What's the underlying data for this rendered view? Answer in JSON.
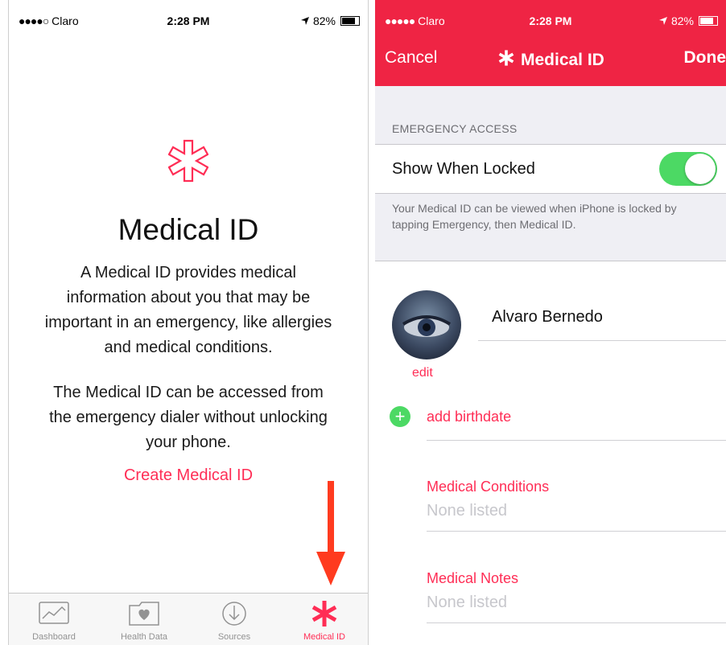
{
  "left": {
    "status": {
      "carrier": "Claro",
      "signal": "●●●●○",
      "time": "2:28 PM",
      "battery": "82%"
    },
    "title": "Medical ID",
    "description": "A Medical ID provides medical information about you that may be important in an emergency, like allergies and medical conditions.",
    "description2": "The Medical ID can be accessed from the emergency dialer without unlocking your phone.",
    "create_link": "Create Medical ID",
    "tabs": [
      {
        "label": "Dashboard",
        "icon": "dashboard-icon"
      },
      {
        "label": "Health Data",
        "icon": "health-data-icon"
      },
      {
        "label": "Sources",
        "icon": "sources-icon"
      },
      {
        "label": "Medical ID",
        "icon": "medical-id-icon"
      }
    ],
    "colors": {
      "accent": "#ff2d55",
      "arrow": "#ff3b1f"
    }
  },
  "right": {
    "status": {
      "carrier": "Claro",
      "signal": "●●●●●",
      "time": "2:28 PM",
      "battery": "82%"
    },
    "nav": {
      "cancel": "Cancel",
      "title": "Medical ID",
      "done": "Done"
    },
    "section_header": "EMERGENCY ACCESS",
    "toggle": {
      "label": "Show When Locked",
      "on": true
    },
    "note": "Your Medical ID can be viewed when iPhone is locked by tapping Emergency, then Medical ID.",
    "profile": {
      "name": "Alvaro Bernedo",
      "edit": "edit"
    },
    "add_birthdate": "add birthdate",
    "fields": [
      {
        "label": "Medical Conditions",
        "value": "None listed"
      },
      {
        "label": "Medical Notes",
        "value": "None listed"
      }
    ],
    "colors": {
      "nav_bg": "#ef2444",
      "toggle_on": "#4cd964"
    }
  }
}
